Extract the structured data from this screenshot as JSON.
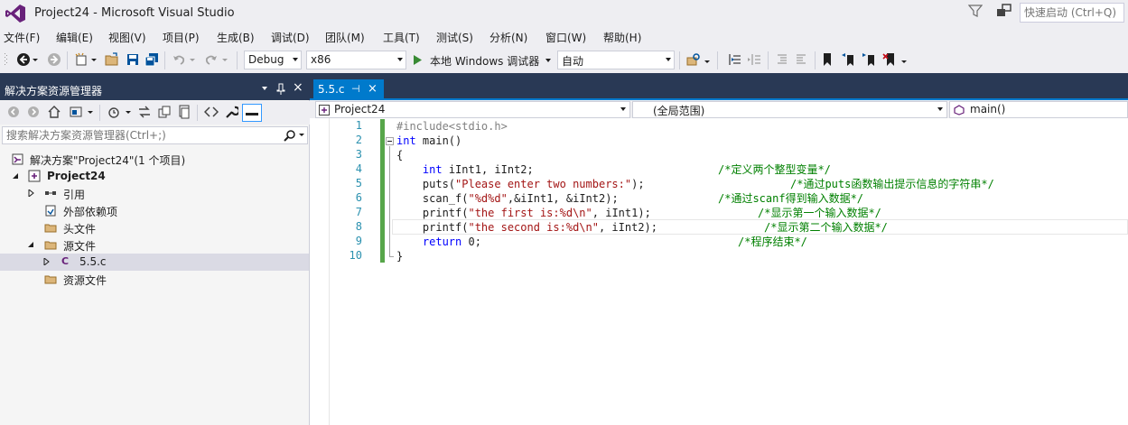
{
  "window": {
    "title": "Project24 - Microsoft Visual Studio",
    "quick_launch_placeholder": "快速启动 (Ctrl+Q)"
  },
  "menu": [
    "文件(F)",
    "编辑(E)",
    "视图(V)",
    "项目(P)",
    "生成(B)",
    "调试(D)",
    "团队(M)",
    "工具(T)",
    "测试(S)",
    "分析(N)",
    "窗口(W)",
    "帮助(H)"
  ],
  "toolbar": {
    "config": "Debug",
    "platform": "x86",
    "run_label": "本地 Windows 调试器",
    "auto": "自动"
  },
  "solution_explorer": {
    "title": "解决方案资源管理器",
    "search_placeholder": "搜索解决方案资源管理器(Ctrl+;)",
    "tree": [
      {
        "label": "解决方案\"Project24\"(1 个项目)"
      },
      {
        "label": "Project24"
      },
      {
        "label": "引用"
      },
      {
        "label": "外部依赖项"
      },
      {
        "label": "头文件"
      },
      {
        "label": "源文件"
      },
      {
        "label": "5.5.c"
      },
      {
        "label": "资源文件"
      }
    ]
  },
  "editor": {
    "tab": "5.5.c",
    "tab_pin": "⊣",
    "tab_close": "×",
    "nav_project": "Project24",
    "nav_scope": "(全局范围)",
    "nav_member": "main()",
    "line_numbers": [
      "1",
      "2",
      "3",
      "4",
      "5",
      "6",
      "7",
      "8",
      "9",
      "10"
    ],
    "lines": [
      {
        "code": "#include<stdio.h>",
        "comment": ""
      },
      {
        "code": "int main()",
        "comment": ""
      },
      {
        "code": "{",
        "comment": ""
      },
      {
        "code": "    int iInt1, iInt2;",
        "comment": "/*定义两个整型变量*/"
      },
      {
        "code": "    puts(\"Please enter two numbers:\");",
        "comment": "/*通过puts函数输出提示信息的字符串*/"
      },
      {
        "code": "    scan_f(\"%d%d\",&iInt1, &iInt2);",
        "comment": "/*通过scanf得到输入数据*/"
      },
      {
        "code": "    printf(\"the first is:%d\\n\", iInt1);",
        "comment": "/*显示第一个输入数据*/"
      },
      {
        "code": "    printf(\"the second is:%d\\n\", iInt2);",
        "comment": "/*显示第二个输入数据*/"
      },
      {
        "code": "    return 0;",
        "comment": "/*程序结束*/"
      },
      {
        "code": "}",
        "comment": ""
      }
    ]
  },
  "colors": {
    "accent": "#007acc",
    "header": "#293955",
    "keyword": "#0000ff",
    "string": "#a31515",
    "comment": "#008000",
    "line_number": "#2b91af"
  }
}
